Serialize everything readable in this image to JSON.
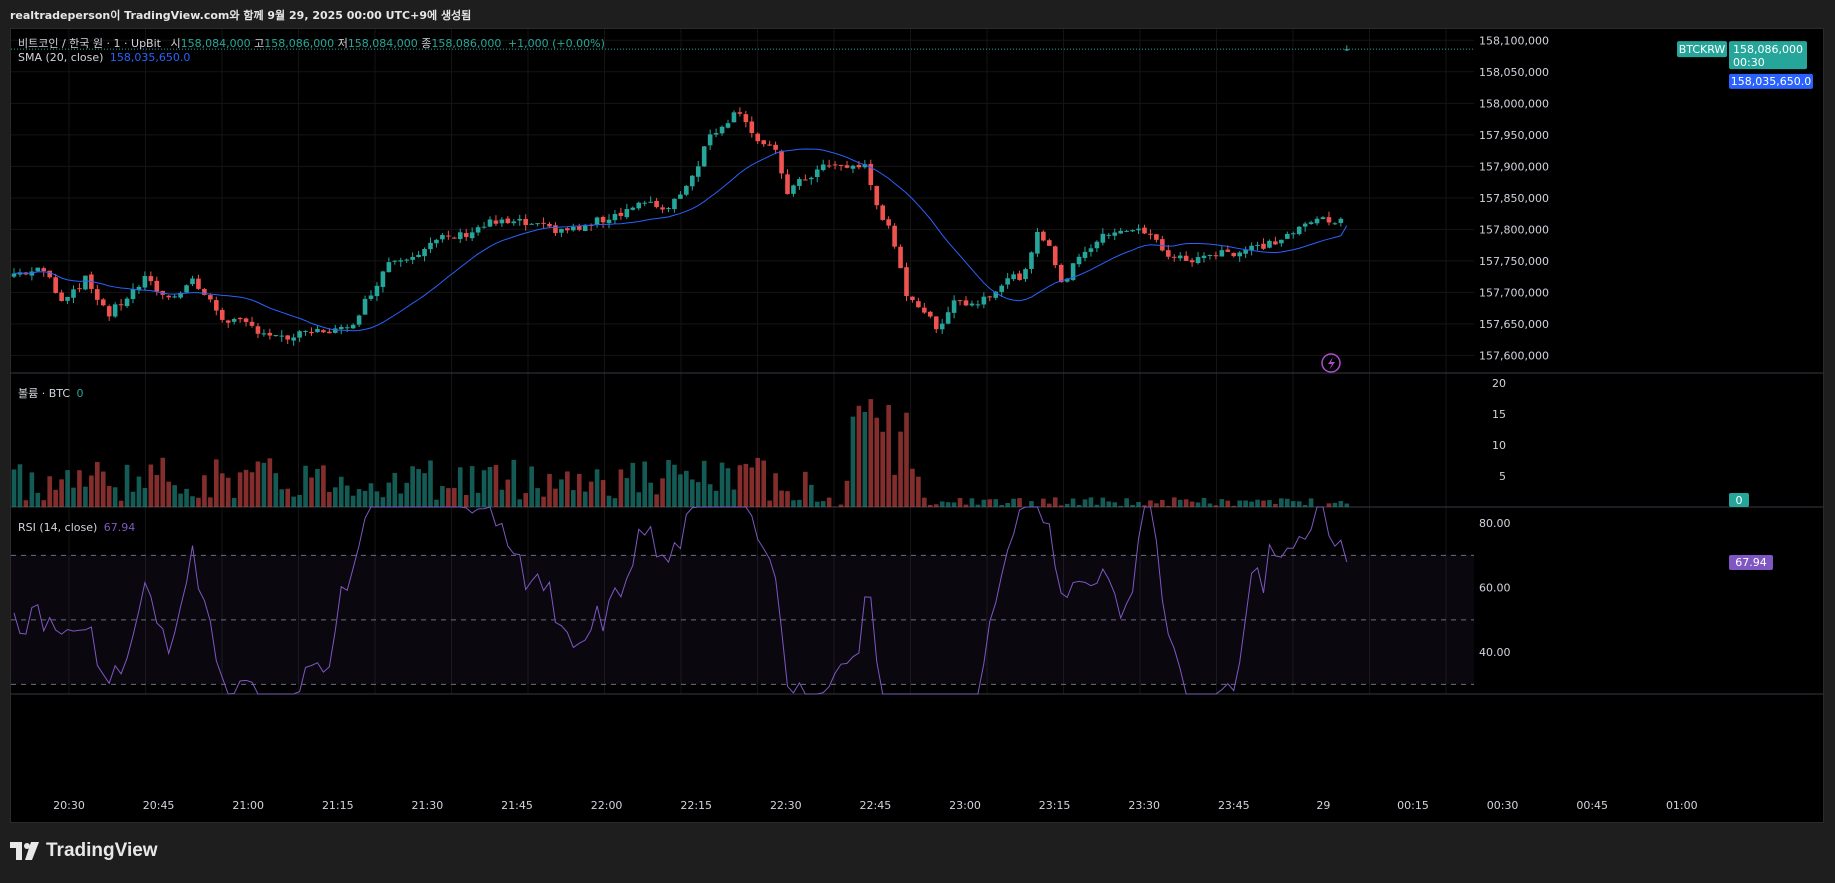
{
  "header": {
    "attribution": "realtradeperson이 TradingView.com와 함께 9월 29, 2025 00:00 UTC+9에 생성됨"
  },
  "legend": {
    "symbol_line": "비트코인 / 한국 원 · 1 · UpBit",
    "o_label": "시",
    "o_value": "158,084,000",
    "h_label": "고",
    "h_value": "158,086,000",
    "l_label": "저",
    "l_value": "158,084,000",
    "c_label": "종",
    "c_value": "158,086,000",
    "change": "+1,000 (+0.00%)",
    "sma_label": "SMA (20, close)",
    "sma_value": "158,035,650.0",
    "volume_label": "볼륨 · BTC",
    "volume_value": "0",
    "rsi_label": "RSI (14, close)",
    "rsi_value": "67.94"
  },
  "price_tags": {
    "symbol": "BTCKRW",
    "last_price": "158,086,000",
    "countdown": "00:30",
    "sma_price": "158,035,650.0",
    "volume_tag": "0",
    "rsi_tag": "67.94"
  },
  "colors": {
    "up": "#26a69a",
    "down": "#ef5350",
    "sma": "#2962ff",
    "rsi": "#7e57c2",
    "sma_tag": "#2962ff",
    "rsi_tag": "#7e57c2"
  },
  "footer": {
    "brand": "TradingView"
  },
  "chart_data": {
    "type": "candlestick",
    "price_axis_labels": [
      "158,100,000",
      "158,050,000",
      "158,000,000",
      "157,950,000",
      "157,900,000",
      "157,850,000",
      "157,800,000",
      "157,750,000",
      "157,700,000",
      "157,650,000",
      "157,600,000"
    ],
    "price_range": [
      157580000,
      158110000
    ],
    "volume_axis_labels": [
      "20",
      "15",
      "10",
      "5"
    ],
    "volume_range": [
      0,
      20
    ],
    "rsi_axis_labels": [
      "80.00",
      "60.00",
      "40.00"
    ],
    "rsi_range": [
      27,
      85
    ],
    "rsi_bands": [
      70,
      50,
      30
    ],
    "time_axis_labels": [
      "20:30",
      "20:45",
      "21:00",
      "21:15",
      "21:30",
      "21:45",
      "22:00",
      "22:15",
      "22:30",
      "22:45",
      "23:00",
      "23:15",
      "23:30",
      "23:45",
      "29",
      "00:15",
      "00:30",
      "00:45",
      "01:00"
    ],
    "candles_count": 225,
    "close_path": [
      [
        0,
        157730000
      ],
      [
        5,
        157735000
      ],
      [
        8,
        157690000
      ],
      [
        12,
        157720000
      ],
      [
        16,
        157665000
      ],
      [
        22,
        157720000
      ],
      [
        26,
        157690000
      ],
      [
        30,
        157720000
      ],
      [
        35,
        157660000
      ],
      [
        40,
        157645000
      ],
      [
        45,
        157625000
      ],
      [
        52,
        157640000
      ],
      [
        56,
        157640000
      ],
      [
        60,
        157700000
      ],
      [
        63,
        157750000
      ],
      [
        68,
        157765000
      ],
      [
        72,
        157785000
      ],
      [
        75,
        157790000
      ],
      [
        80,
        157810000
      ],
      [
        85,
        157810000
      ],
      [
        90,
        157800000
      ],
      [
        95,
        157800000
      ],
      [
        100,
        157820000
      ],
      [
        105,
        157840000
      ],
      [
        110,
        157835000
      ],
      [
        114,
        157885000
      ],
      [
        117,
        157950000
      ],
      [
        120,
        157975000
      ],
      [
        122,
        157990000
      ],
      [
        125,
        157940000
      ],
      [
        128,
        157920000
      ],
      [
        130,
        157860000
      ],
      [
        133,
        157880000
      ],
      [
        136,
        157900000
      ],
      [
        140,
        157900000
      ],
      [
        143,
        157900000
      ],
      [
        145,
        157840000
      ],
      [
        147,
        157800000
      ],
      [
        150,
        157700000
      ],
      [
        153,
        157670000
      ],
      [
        155,
        157640000
      ],
      [
        158,
        157690000
      ],
      [
        161,
        157680000
      ],
      [
        164,
        157700000
      ],
      [
        167,
        157720000
      ],
      [
        170,
        157730000
      ],
      [
        172,
        157790000
      ],
      [
        174,
        157780000
      ],
      [
        176,
        157710000
      ],
      [
        179,
        157760000
      ],
      [
        182,
        157780000
      ],
      [
        185,
        157800000
      ],
      [
        188,
        157800000
      ],
      [
        191,
        157790000
      ],
      [
        194,
        157760000
      ],
      [
        197,
        157750000
      ],
      [
        200,
        157755000
      ],
      [
        203,
        157770000
      ],
      [
        205,
        157760000
      ],
      [
        208,
        157770000
      ],
      [
        212,
        157780000
      ],
      [
        216,
        157800000
      ],
      [
        220,
        157820000
      ],
      [
        223,
        157810000
      ],
      [
        224,
        157790000
      ]
    ],
    "rsi_last": 67.94
  }
}
